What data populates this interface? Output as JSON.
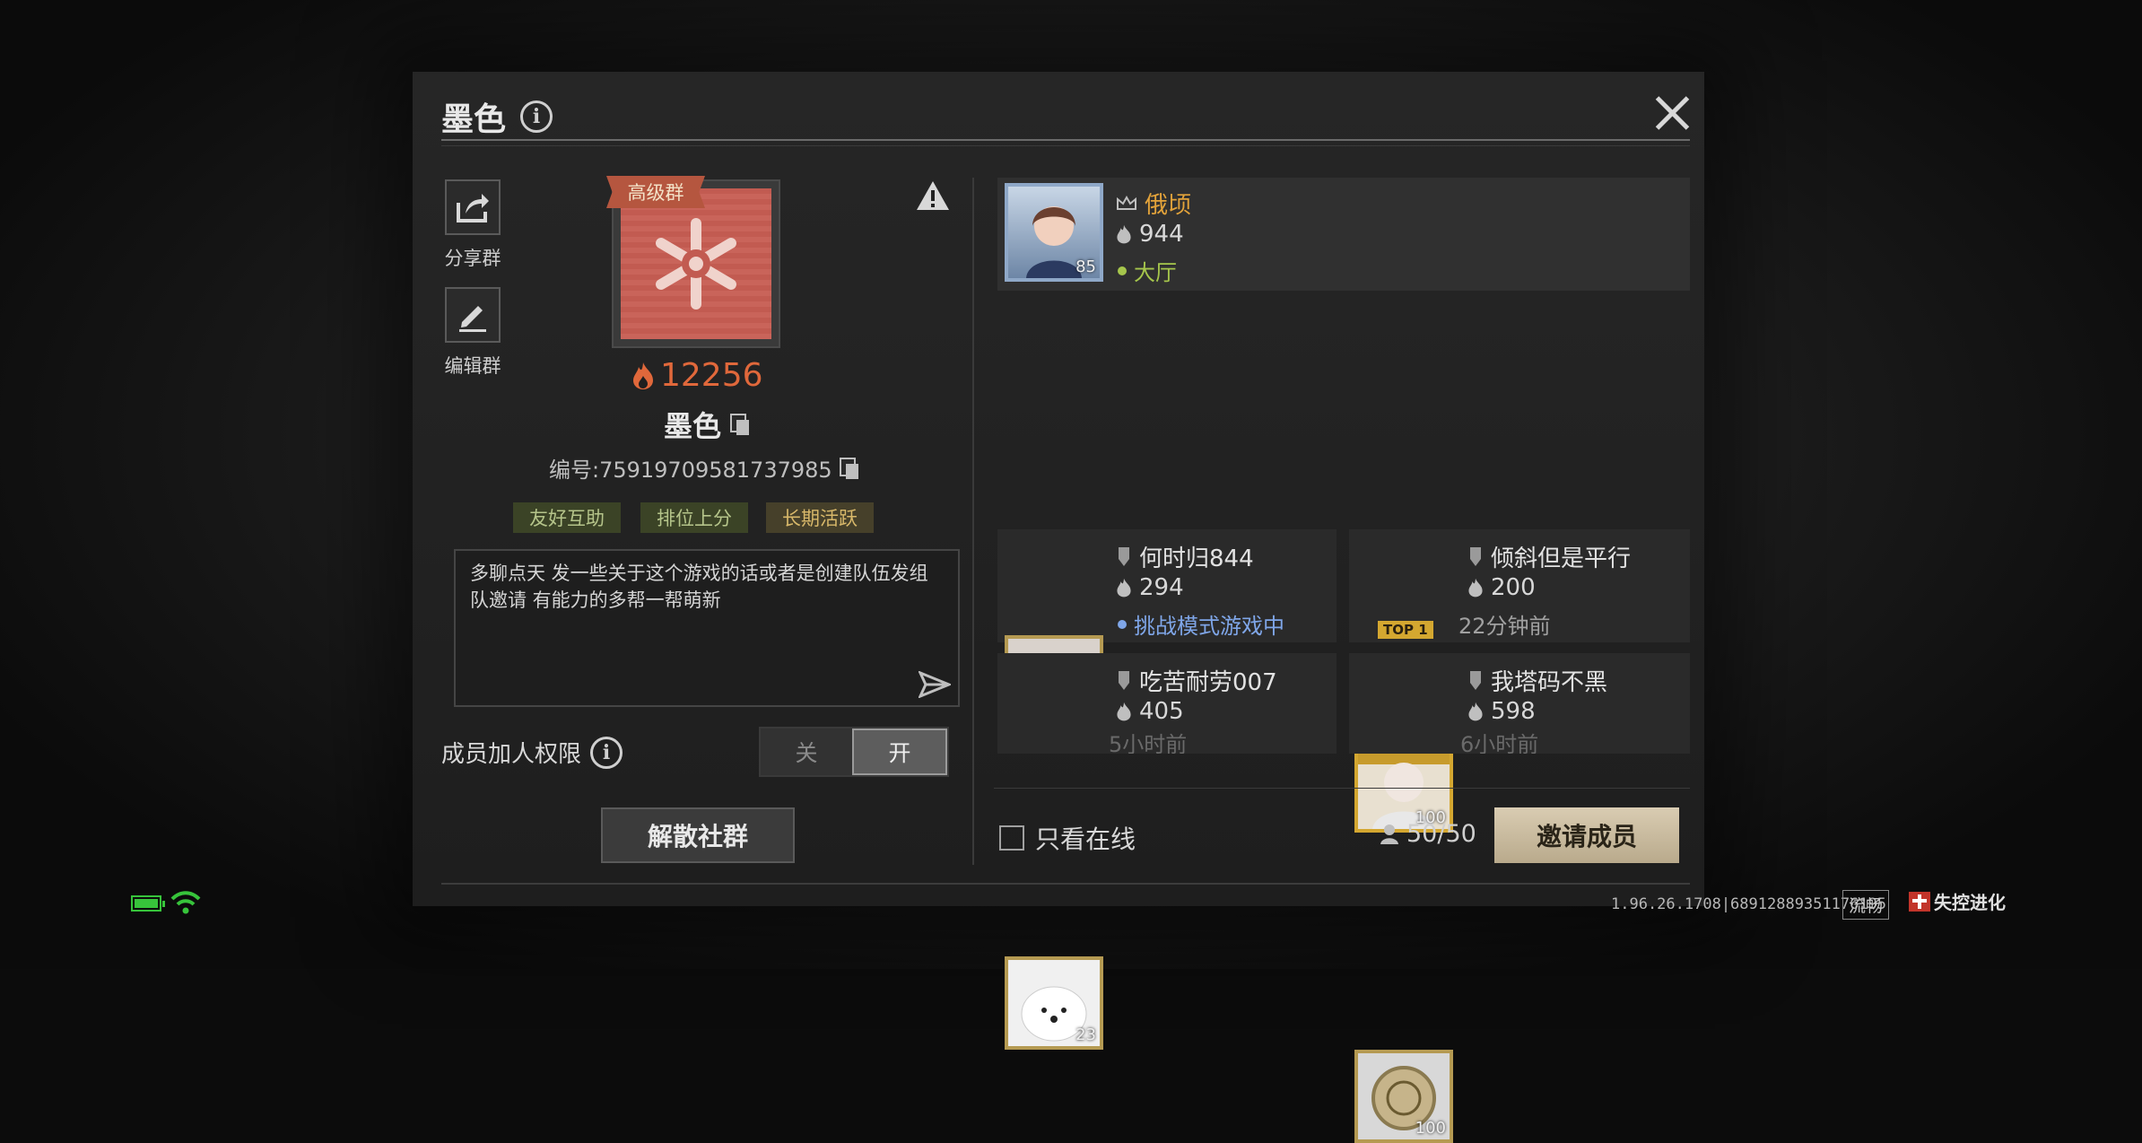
{
  "header": {
    "title": "墨色"
  },
  "side_actions": {
    "share_label": "分享群",
    "edit_label": "编辑群"
  },
  "group": {
    "badge": "高级群",
    "heat": "12256",
    "name": "墨色",
    "id_text": "编号:75919709581737985",
    "tags": [
      "友好互助",
      "排位上分",
      "长期活跃"
    ],
    "description": "多聊点天 发一些关于这个游戏的话或者是创建队伍发组队邀请 有能力的多帮一帮萌新"
  },
  "permission": {
    "label": "成员加人权限",
    "off": "关",
    "on": "开",
    "state": "on"
  },
  "dissolve_label": "解散社群",
  "members": [
    {
      "name": "俄顷",
      "heat": "944",
      "status": "大厅",
      "level": "85",
      "role": "owner"
    },
    {
      "name": "何时归844",
      "heat": "294",
      "status": "挑战模式游戏中",
      "level": "100",
      "role": "member"
    },
    {
      "name": "倾斜但是平行",
      "heat": "200",
      "status": "22分钟前",
      "level": "100",
      "role": "member",
      "avatar_badge": "TOP 1"
    },
    {
      "name": "吃苦耐劳007",
      "heat": "405",
      "status": "5小时前",
      "level": "23",
      "role": "member"
    },
    {
      "name": "我塔码不黑",
      "heat": "598",
      "status": "6小时前",
      "level": "100",
      "role": "member"
    }
  ],
  "footer": {
    "online_only_label": "只看在线",
    "member_count": "50/50",
    "invite_label": "邀请成员",
    "version": "1.96.26.1708|68912889351176195",
    "smooth": "流畅",
    "logo_text": "失控进化"
  },
  "colors": {
    "heat_orange": "#e0683b",
    "owner_gold": "#e3a33a",
    "lobby_green": "#a6c64c",
    "playing_blue": "#7fa6e8",
    "invite_bg": "#d9ccb2"
  }
}
